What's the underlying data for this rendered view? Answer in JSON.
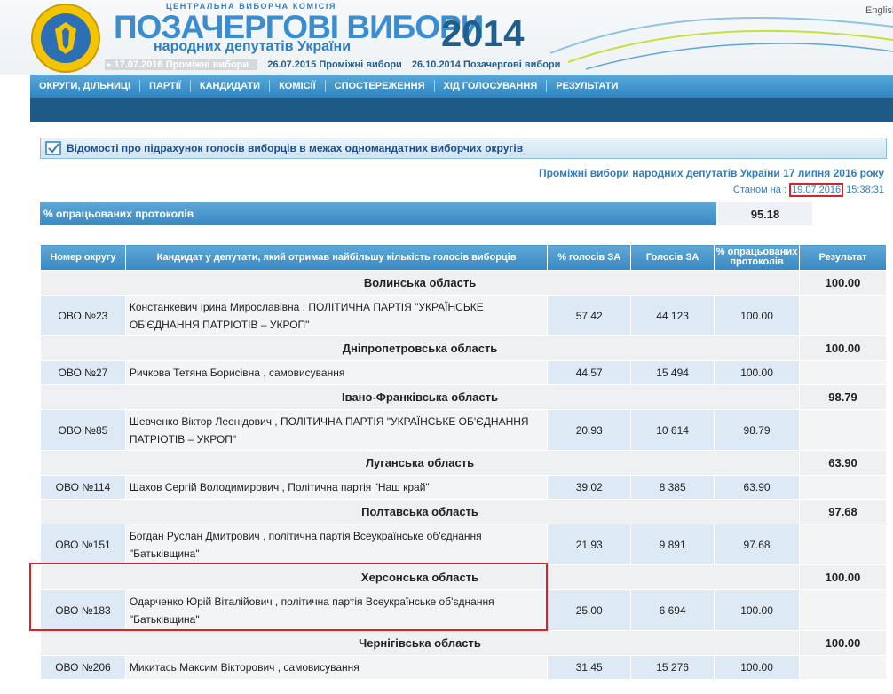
{
  "header": {
    "commission": "ЦЕНТРАЛЬНА ВИБОРЧА КОМІСІЯ",
    "title": "ПОЗАЧЕРГОВІ ВИБОРИ",
    "subtitle": "народних депутатів України",
    "year": "2014",
    "english_link": "English",
    "election_links": [
      "17.07.2016 Проміжні вибори",
      "26.07.2015 Проміжні вибори",
      "26.10.2014 Позачергові вибори"
    ]
  },
  "nav": [
    "ОКРУГИ, ДІЛЬНИЦІ",
    "ПАРТІЇ",
    "КАНДИДАТИ",
    "КОМІСІЇ",
    "СПОСТЕРЕЖЕННЯ",
    "ХІД ГОЛОСУВАННЯ",
    "РЕЗУЛЬТАТИ"
  ],
  "section_title": "Відомості про підрахунок голосів виборців в межах одномандатних виборчих округів",
  "election_name": "Проміжні вибори народних депутатів України 17 липня 2016 року",
  "status": {
    "prefix": "Станом на : ",
    "date": "19.07.2016",
    "time": " 15:38:31"
  },
  "processed": {
    "label": "% опрацьованих протоколів",
    "value": "95.18"
  },
  "table": {
    "headers": [
      "Номер округу",
      "Кандидат у депутати, який отримав найбільшу кількість голосів виборців",
      "% голосів ЗА",
      "Голосів ЗА",
      "% опрацьованих протоколів",
      "Результат"
    ],
    "regions": [
      {
        "name": "Волинська область",
        "result": "100.00",
        "row": {
          "okrug": "ОВО №23",
          "candidate": "Констанкевич Ірина Мирославівна , ПОЛІТИЧНА ПАРТІЯ \"УКРАЇНСЬКЕ ОБ'ЄДНАННЯ ПАТРІОТІВ – УКРОП\"",
          "pct": "57.42",
          "votes": "44 123",
          "processed": "100.00"
        }
      },
      {
        "name": "Дніпропетровська область",
        "result": "100.00",
        "row": {
          "okrug": "ОВО №27",
          "candidate": "Ричкова Тетяна Борисівна , самовисування",
          "pct": "44.57",
          "votes": "15 494",
          "processed": "100.00"
        }
      },
      {
        "name": "Івано-Франківська область",
        "result": "98.79",
        "row": {
          "okrug": "ОВО №85",
          "candidate": "Шевченко Віктор Леонідович , ПОЛІТИЧНА ПАРТІЯ \"УКРАЇНСЬКЕ ОБ'ЄДНАННЯ ПАТРІОТІВ – УКРОП\"",
          "pct": "20.93",
          "votes": "10 614",
          "processed": "98.79"
        }
      },
      {
        "name": "Луганська область",
        "result": "63.90",
        "row": {
          "okrug": "ОВО №114",
          "candidate": "Шахов Сергій Володимирович , Політична партія \"Наш край\"",
          "pct": "39.02",
          "votes": "8 385",
          "processed": "63.90"
        }
      },
      {
        "name": "Полтавська область",
        "result": "97.68",
        "row": {
          "okrug": "ОВО №151",
          "candidate": "Богдан Руслан Дмитрович , політична партія Всеукраїнське об'єднання \"Батьківщина\"",
          "pct": "21.93",
          "votes": "9 891",
          "processed": "97.68"
        }
      },
      {
        "name": "Херсонська область",
        "result": "100.00",
        "row": {
          "okrug": "ОВО №183",
          "candidate": "Одарченко Юрій Віталійович , політична партія Всеукраїнське об'єднання \"Батьківщина\"",
          "pct": "25.00",
          "votes": "6 694",
          "processed": "100.00"
        }
      },
      {
        "name": "Чернігівська область",
        "result": "100.00",
        "row": {
          "okrug": "ОВО №206",
          "candidate": "Микитась Максим Вікторович , самовисування",
          "pct": "31.45",
          "votes": "15 276",
          "processed": "100.00"
        }
      }
    ]
  },
  "colors": {
    "nav": "#3a89c4",
    "subnav": "#1d5a86",
    "highlight": "#d9232a",
    "title": "#3a8dd0",
    "year": "#1e5f8e"
  }
}
